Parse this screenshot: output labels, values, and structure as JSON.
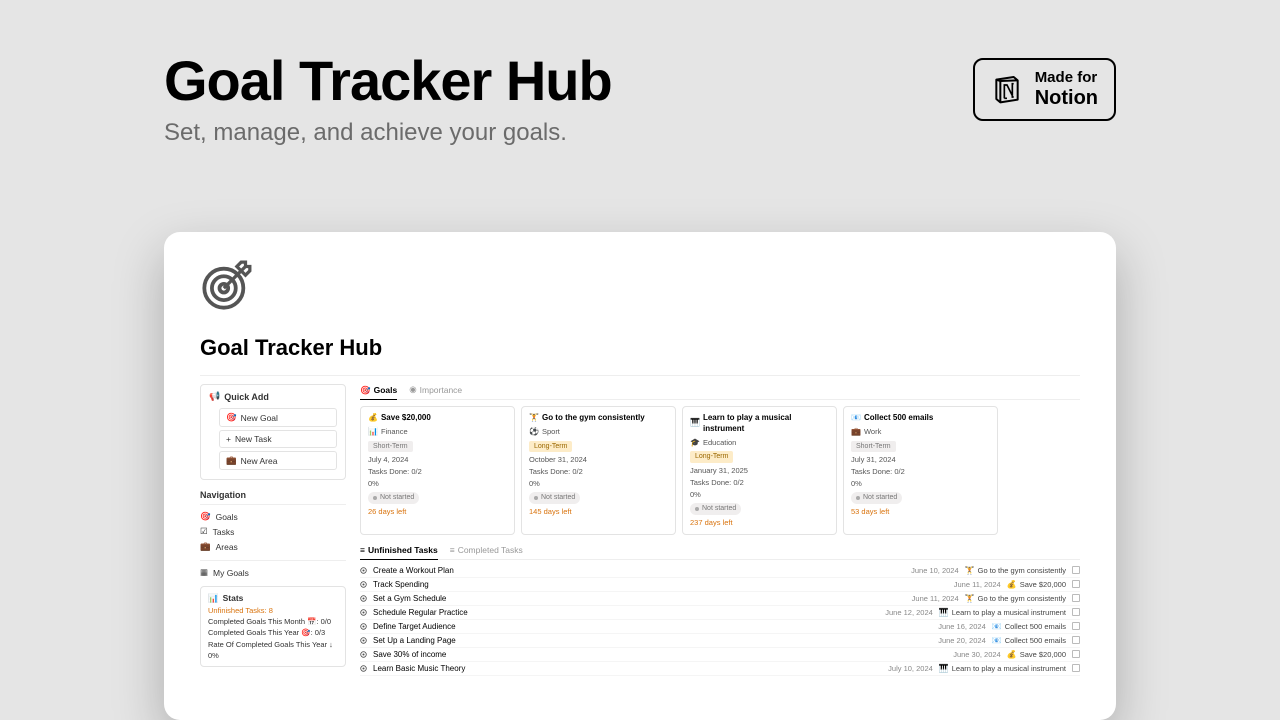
{
  "hero": {
    "title": "Goal Tracker Hub",
    "subtitle": "Set, manage, and achieve your goals."
  },
  "badge": {
    "line1": "Made for",
    "line2": "Notion"
  },
  "window": {
    "title": "Goal Tracker Hub"
  },
  "sidebar": {
    "quickadd": {
      "title": "Quick Add",
      "newGoal": "New Goal",
      "newTask": "New Task",
      "newArea": "New Area"
    },
    "navTitle": "Navigation",
    "nav": {
      "goals": "Goals",
      "tasks": "Tasks",
      "areas": "Areas",
      "mygoals": "My Goals"
    },
    "stats": {
      "title": "Stats",
      "unfinished": "Unfinished Tasks: 8",
      "month": "Completed Goals This Month 📅: 0/0",
      "year": "Completed Goals This Year 🎯: 0/3",
      "rate": "Rate Of Completed Goals This Year ↓",
      "pct": "0%"
    }
  },
  "tabs": {
    "goals": "Goals",
    "importance": "Importance"
  },
  "cards": [
    {
      "emoji": "💰",
      "title": "Save $20,000",
      "areaEmoji": "📊",
      "area": "Finance",
      "termClass": "short",
      "term": "Short-Term",
      "date": "July 4, 2024",
      "tasks": "Tasks Done: 0/2",
      "pct": "0%",
      "status": "Not started",
      "days": "26 days left"
    },
    {
      "emoji": "🏋️",
      "title": "Go to the gym consistently",
      "areaEmoji": "⚽",
      "area": "Sport",
      "termClass": "long",
      "term": "Long-Term",
      "date": "October 31, 2024",
      "tasks": "Tasks Done: 0/2",
      "pct": "0%",
      "status": "Not started",
      "days": "145 days left"
    },
    {
      "emoji": "🎹",
      "title": "Learn to play a musical instrument",
      "areaEmoji": "🎓",
      "area": "Education",
      "termClass": "long",
      "term": "Long-Term",
      "date": "January 31, 2025",
      "tasks": "Tasks Done: 0/2",
      "pct": "0%",
      "status": "Not started",
      "days": "237 days left"
    },
    {
      "emoji": "📧",
      "title": "Collect 500 emails",
      "areaEmoji": "💼",
      "area": "Work",
      "termClass": "short",
      "term": "Short-Term",
      "date": "July 31, 2024",
      "tasks": "Tasks Done: 0/2",
      "pct": "0%",
      "status": "Not started",
      "days": "53 days left"
    }
  ],
  "taskTabs": {
    "unfinished": "Unfinished Tasks",
    "completed": "Completed Tasks"
  },
  "tasks": [
    {
      "name": "Create a Workout Plan",
      "date": "June 10, 2024",
      "goalEmoji": "🏋️",
      "goal": "Go to the gym consistently"
    },
    {
      "name": "Track Spending",
      "date": "June 11, 2024",
      "goalEmoji": "💰",
      "goal": "Save $20,000"
    },
    {
      "name": "Set a Gym Schedule",
      "date": "June 11, 2024",
      "goalEmoji": "🏋️",
      "goal": "Go to the gym consistently"
    },
    {
      "name": "Schedule Regular Practice",
      "date": "June 12, 2024",
      "goalEmoji": "🎹",
      "goal": "Learn to play a musical instrument"
    },
    {
      "name": "Define Target Audience",
      "date": "June 16, 2024",
      "goalEmoji": "📧",
      "goal": "Collect 500 emails"
    },
    {
      "name": "Set Up a Landing Page",
      "date": "June 20, 2024",
      "goalEmoji": "📧",
      "goal": "Collect 500 emails"
    },
    {
      "name": "Save 30% of income",
      "date": "June 30, 2024",
      "goalEmoji": "💰",
      "goal": "Save $20,000"
    },
    {
      "name": "Learn Basic Music Theory",
      "date": "July 10, 2024",
      "goalEmoji": "🎹",
      "goal": "Learn to play a musical instrument"
    }
  ]
}
